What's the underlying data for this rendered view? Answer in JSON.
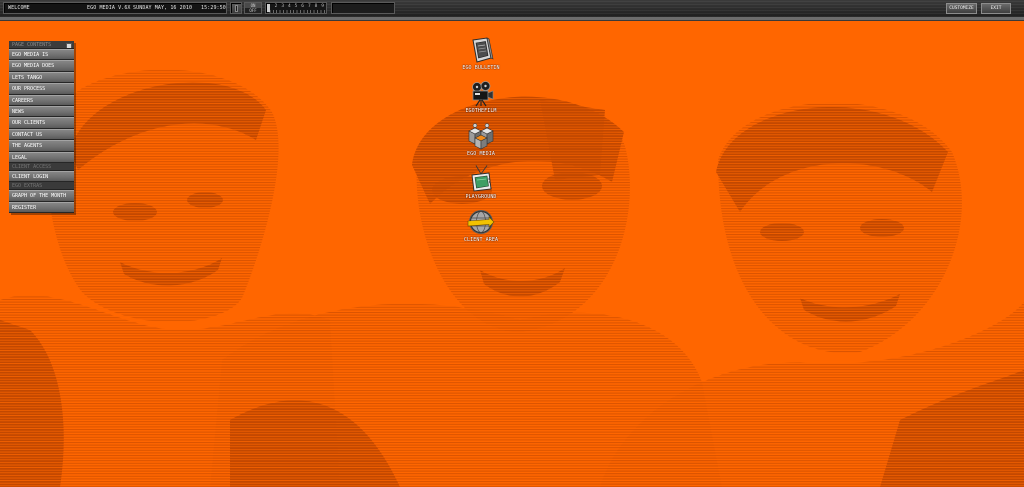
{
  "topbar": {
    "welcome": "WELCOME",
    "version": "EGO MEDIA V.6X",
    "date": "SUNDAY MAY, 16 2010",
    "time": "15:29:50",
    "toggle_on": "ON",
    "toggle_off": "OFF",
    "ruler": [
      "1",
      "2",
      "3",
      "4",
      "5",
      "6",
      "7",
      "8",
      "9"
    ],
    "customize_label": "CUSTOMIZE",
    "exit_label": "EXIT"
  },
  "menu": {
    "header": "PAGE CONTENTS",
    "items": [
      "EGO MEDIA IS",
      "EGO MEDIA DOES",
      "LETS TANGO",
      "OUR PROCESS",
      "CAREERS",
      "NEWS",
      "OUR CLIENTS",
      "CONTACT US",
      "THE AGENTS",
      "LEGAL"
    ],
    "client_header": "CLIENT ACCESS",
    "client_items": [
      "CLIENT LOGIN"
    ],
    "extras_header": "EGO EXTRAS",
    "extras_items": [
      "GRAPH OF THE MONTH",
      "REGISTER"
    ]
  },
  "desktop_icons": [
    {
      "label": "EGO BULLETIN",
      "icon": "bulletin-board-icon"
    },
    {
      "label": "EGOTHEFILM",
      "icon": "film-camera-icon"
    },
    {
      "label": "EGO MEDIA",
      "icon": "ego-media-blocks-icon"
    },
    {
      "label": "PLAYGROUND",
      "icon": "television-icon"
    },
    {
      "label": "CLIENT AREA",
      "icon": "globe-gear-icon"
    }
  ],
  "colors": {
    "background": "#ff6600",
    "halftone": "#d95300",
    "halftone_dark": "#c24800",
    "topbar": "#262626",
    "menu_item": "#6f6f6f",
    "menu_section": "#3a3a3a",
    "text": "#ffffff"
  }
}
